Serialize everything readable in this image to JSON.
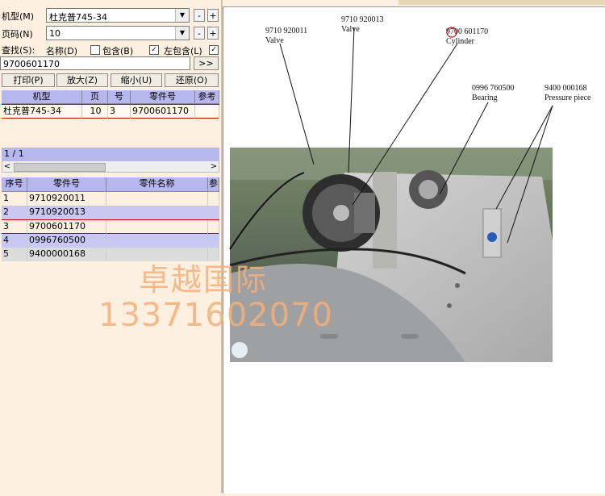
{
  "form": {
    "model_label": "机型(M)",
    "model_value": "杜克普745-34",
    "page_label": "页码(N)",
    "page_value": "10",
    "search_label": "查找(S):",
    "name_label": "名称(D)",
    "include_label": "包含(B)",
    "left_include_label": "左包含(L)",
    "search_value": "9700601170",
    "go_label": ">>",
    "minus": "-",
    "plus": "+",
    "check_mark": "✓"
  },
  "toolbar": {
    "print": "打印(P)",
    "zoom_in": "放大(Z)",
    "zoom_out": "缩小(U)",
    "restore": "还原(O)"
  },
  "grid1": {
    "headers": [
      "机型",
      "页",
      "号",
      "零件号",
      "参考"
    ],
    "rows": [
      {
        "model": "杜克普745-34",
        "page": "10",
        "num": "3",
        "part": "9700601170",
        "ref": ""
      }
    ]
  },
  "pager": {
    "text": "1 / 1",
    "left_arrow": "<",
    "right_arrow": ">"
  },
  "grid2": {
    "headers": [
      "序号",
      "零件号",
      "零件名称",
      "参"
    ],
    "rows": [
      {
        "idx": "1",
        "part": "9710920011",
        "name": "",
        "ref": ""
      },
      {
        "idx": "2",
        "part": "9710920013",
        "name": "",
        "ref": ""
      },
      {
        "idx": "3",
        "part": "9700601170",
        "name": "",
        "ref": ""
      },
      {
        "idx": "4",
        "part": "0996760500",
        "name": "",
        "ref": ""
      },
      {
        "idx": "5",
        "part": "9400000168",
        "name": "",
        "ref": ""
      }
    ]
  },
  "watermark": {
    "line1": "卓越国际",
    "line2": "13371602070",
    "color": "#f5b07a"
  },
  "diagram": {
    "labels": [
      {
        "number": "9710 920011",
        "name": "Valve"
      },
      {
        "number": "9710 920013",
        "name": "Valve"
      },
      {
        "number": "9700 601170",
        "name": "Cylinder"
      },
      {
        "number": "0996 760500",
        "name": "Bearing"
      },
      {
        "number": "9400 000168",
        "name": "Pressure piece"
      }
    ]
  },
  "colors": {
    "header_bg": "#b7b7ef",
    "selected_border": "#d00000",
    "panel_bg": "#fdf0e0"
  }
}
